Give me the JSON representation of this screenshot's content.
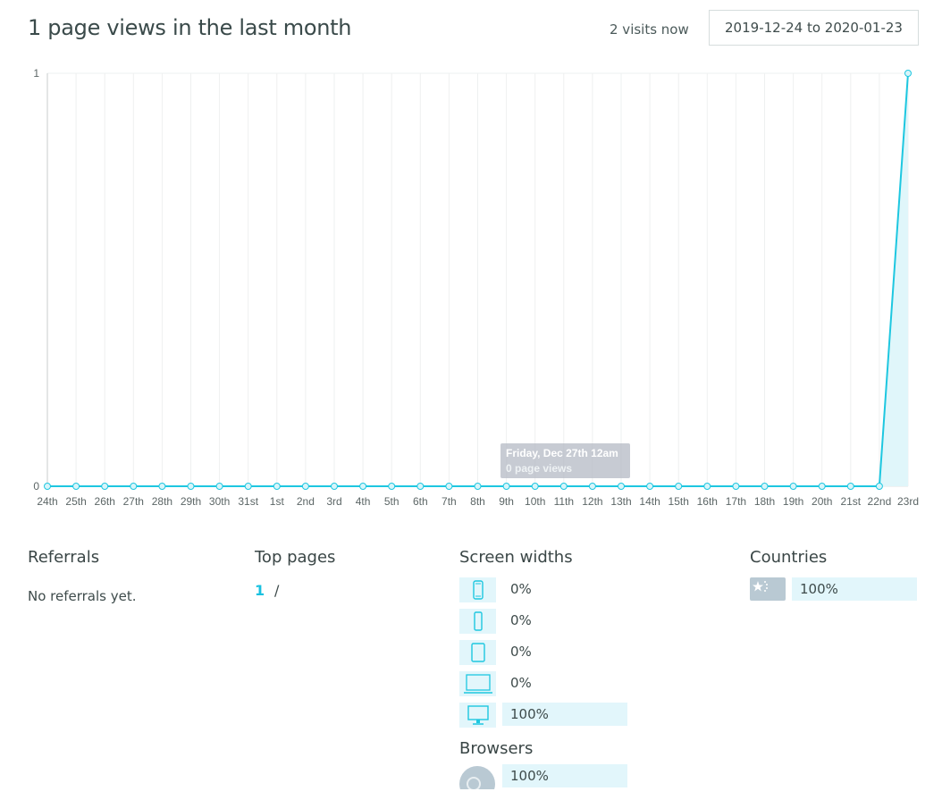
{
  "header": {
    "title": "1 page views in the last month",
    "visits_now": "2 visits now",
    "date_range": "2019-12-24 to 2020-01-23"
  },
  "chart_data": {
    "type": "area",
    "categories": [
      "24th",
      "25th",
      "26th",
      "27th",
      "28th",
      "29th",
      "30th",
      "31st",
      "1st",
      "2nd",
      "3rd",
      "4th",
      "5th",
      "6th",
      "7th",
      "8th",
      "9th",
      "10th",
      "11th",
      "12th",
      "13th",
      "14th",
      "15th",
      "16th",
      "17th",
      "18th",
      "19th",
      "20th",
      "21st",
      "22nd",
      "23rd"
    ],
    "series": [
      {
        "values": [
          0,
          0,
          0,
          0,
          0,
          0,
          0,
          0,
          0,
          0,
          0,
          0,
          0,
          0,
          0,
          0,
          0,
          0,
          0,
          0,
          0,
          0,
          0,
          0,
          0,
          0,
          0,
          0,
          0,
          0,
          1
        ]
      }
    ],
    "y_ticks": [
      "0",
      "1"
    ],
    "ylim": [
      0,
      1
    ],
    "grid": true,
    "colors": {
      "line": "#1ec7e0",
      "fill": "#e0f6fa",
      "point_fill": "#d8f5fa"
    },
    "tooltip": {
      "title": "Friday, Dec 27th 12am",
      "value": "0 page views"
    }
  },
  "referrals": {
    "title": "Referrals",
    "empty_text": "No referrals yet."
  },
  "top_pages": {
    "title": "Top pages",
    "items": [
      {
        "count": "1",
        "path": "/"
      }
    ]
  },
  "screen_widths": {
    "title": "Screen widths",
    "items": [
      {
        "icon": "phone-small-icon",
        "percent": "0%",
        "fraction": 0
      },
      {
        "icon": "phone-icon",
        "percent": "0%",
        "fraction": 0
      },
      {
        "icon": "tablet-icon",
        "percent": "0%",
        "fraction": 0
      },
      {
        "icon": "laptop-icon",
        "percent": "0%",
        "fraction": 0
      },
      {
        "icon": "desktop-icon",
        "percent": "100%",
        "fraction": 1
      }
    ]
  },
  "browsers": {
    "title": "Browsers",
    "items": [
      {
        "icon": "browser-icon",
        "percent": "100%",
        "fraction": 1
      }
    ]
  },
  "countries": {
    "title": "Countries",
    "items": [
      {
        "icon": "flag-icon",
        "percent": "100%",
        "fraction": 1
      }
    ]
  },
  "accent": "#1ec7e0"
}
